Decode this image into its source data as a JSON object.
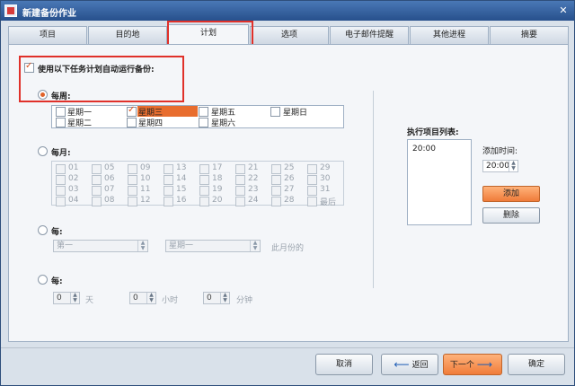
{
  "window": {
    "title": "新建备份作业"
  },
  "tabs": [
    {
      "label": "项目"
    },
    {
      "label": "目的地"
    },
    {
      "label": "计划"
    },
    {
      "label": "选项"
    },
    {
      "label": "电子邮件提醒"
    },
    {
      "label": "其他进程"
    },
    {
      "label": "摘要"
    }
  ],
  "schedule": {
    "enable_label": "使用以下任务计划自动运行备份:",
    "weekly": {
      "label": "每周:",
      "days": [
        {
          "label": "星期一",
          "checked": false
        },
        {
          "label": "星期三",
          "checked": true
        },
        {
          "label": "星期五",
          "checked": false
        },
        {
          "label": "星期日",
          "checked": false
        },
        {
          "label": "星期二",
          "checked": false
        },
        {
          "label": "星期四",
          "checked": false
        },
        {
          "label": "星期六",
          "checked": false
        }
      ]
    },
    "monthly": {
      "label": "每月:",
      "days": [
        "01",
        "05",
        "09",
        "13",
        "17",
        "21",
        "25",
        "29",
        "02",
        "06",
        "10",
        "14",
        "18",
        "22",
        "26",
        "30",
        "03",
        "07",
        "11",
        "15",
        "19",
        "23",
        "27",
        "31",
        "04",
        "08",
        "12",
        "16",
        "20",
        "24",
        "28",
        "最后"
      ]
    },
    "per_month": {
      "label": "每:",
      "ordinal": "第一",
      "weekday": "星期一",
      "suffix": "此月份的"
    },
    "interval": {
      "label": "每:",
      "days_value": "0",
      "days_unit": "天",
      "hours_value": "0",
      "hours_unit": "小时",
      "minutes_value": "0",
      "minutes_unit": "分钟"
    }
  },
  "run_list": {
    "title": "执行项目列表:",
    "items": [
      "20:00"
    ],
    "add_time_label": "添加时间:",
    "time_value": "20:00",
    "add_button": "添加",
    "delete_button": "删除"
  },
  "footer": {
    "cancel": "取消",
    "back": "返回",
    "next": "下一个",
    "ok": "确定"
  },
  "colors": {
    "accent": "#e86d2e",
    "highlight": "#e0312a",
    "titlebar": "#27508c"
  }
}
